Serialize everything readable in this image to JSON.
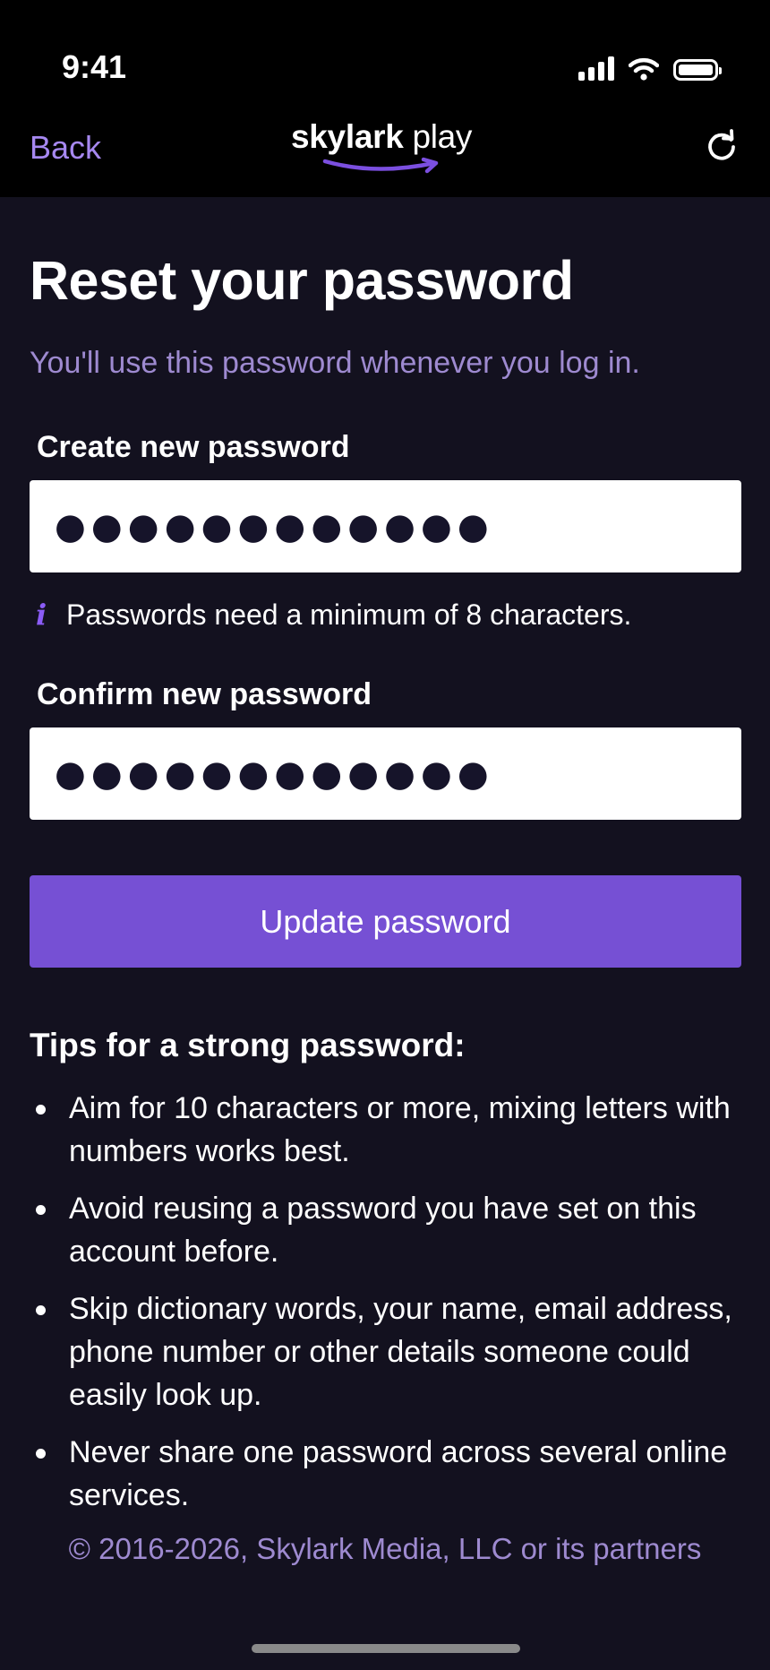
{
  "status_bar": {
    "time": "9:41",
    "icons": [
      "signal-icon",
      "wifi-icon",
      "battery-icon"
    ]
  },
  "nav": {
    "back_label": "Back",
    "logo": {
      "bold": "skylark",
      "light": "play"
    },
    "refresh_icon": "refresh-icon"
  },
  "main": {
    "title": "Reset your password",
    "subtitle": "You'll use this password whenever you log in.",
    "new_password": {
      "label": "Create new password",
      "value": "●●●●●●●●●●●●"
    },
    "hint": {
      "icon": "info-icon",
      "text": "Passwords need a minimum of 8 characters."
    },
    "confirm_password": {
      "label": "Confirm new password",
      "value": "●●●●●●●●●●●●"
    },
    "submit_label": "Update password",
    "tips": {
      "title": "Tips for a strong password:",
      "items": [
        "Aim for 10 characters or more, mixing letters with numbers works best.",
        "Avoid reusing a password you have set on this account before.",
        "Skip dictionary words, your name, email address, phone number or other details someone could easily look up.",
        "Never share one password across several online services."
      ]
    }
  },
  "footer": {
    "copyright": "© 2016-2026, Skylark Media, LLC or its partners"
  },
  "colors": {
    "background": "#13111f",
    "header": "#000000",
    "accent": "#7650d4",
    "link": "#a688f0",
    "muted_text": "#9e8ad0"
  }
}
